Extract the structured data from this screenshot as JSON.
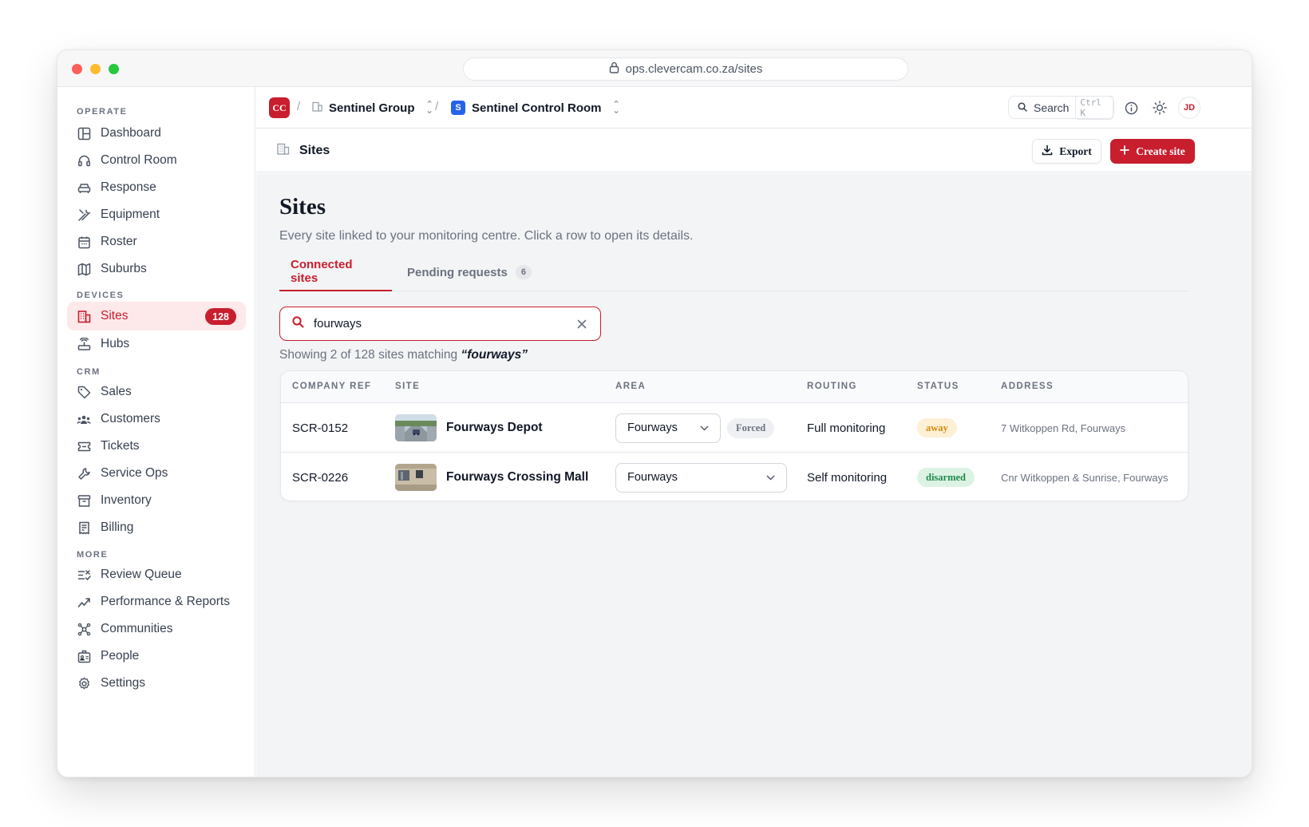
{
  "browser": {
    "url": "ops.clevercam.co.za/sites"
  },
  "sidebar": {
    "sections": [
      {
        "label": "OPERATE",
        "items": [
          {
            "label": "Dashboard",
            "icon": "dashboard-icon"
          },
          {
            "label": "Control Room",
            "icon": "headset-icon"
          },
          {
            "label": "Response",
            "icon": "car-icon"
          },
          {
            "label": "Equipment",
            "icon": "tools-icon"
          },
          {
            "label": "Roster",
            "icon": "calendar-icon"
          },
          {
            "label": "Suburbs",
            "icon": "map-icon"
          }
        ]
      },
      {
        "label": "DEVICES",
        "items": [
          {
            "label": "Sites",
            "icon": "building-icon",
            "badge": "128",
            "active": true
          },
          {
            "label": "Hubs",
            "icon": "router-icon"
          }
        ]
      },
      {
        "label": "CRM",
        "items": [
          {
            "label": "Sales",
            "icon": "tag-icon"
          },
          {
            "label": "Customers",
            "icon": "users-icon"
          },
          {
            "label": "Tickets",
            "icon": "ticket-icon"
          },
          {
            "label": "Service Ops",
            "icon": "wrench-icon"
          },
          {
            "label": "Inventory",
            "icon": "archive-icon"
          },
          {
            "label": "Billing",
            "icon": "receipt-icon"
          }
        ]
      },
      {
        "label": "MORE",
        "items": [
          {
            "label": "Review Queue",
            "icon": "list-check-icon"
          },
          {
            "label": "Performance & Reports",
            "icon": "trend-icon"
          },
          {
            "label": "Communities",
            "icon": "network-icon"
          },
          {
            "label": "People",
            "icon": "id-badge-icon"
          },
          {
            "label": "Settings",
            "icon": "gear-icon"
          }
        ]
      }
    ]
  },
  "topbar": {
    "org_logo": "CC",
    "org_name": "Sentinel Group",
    "room_badge": "S",
    "room_name": "Sentinel Control Room",
    "search_label": "Search",
    "search_shortcut": "Ctrl K",
    "avatar_initials": "JD"
  },
  "pagebar": {
    "title": "Sites",
    "export_label": "Export",
    "create_label": "Create site"
  },
  "page": {
    "heading": "Sites",
    "subtitle": "Every site linked to your monitoring centre. Click a row to open its details.",
    "tabs": [
      {
        "label": "Connected sites",
        "active": true
      },
      {
        "label": "Pending requests",
        "count": "6"
      }
    ],
    "search_value": "fourways",
    "result_prefix": "Showing 2 of 128 sites matching",
    "result_query": "“fourways”"
  },
  "table": {
    "columns": [
      "COMPANY REF",
      "SITE",
      "AREA",
      "ROUTING",
      "STATUS",
      "ADDRESS"
    ],
    "rows": [
      {
        "ref": "SCR-0152",
        "site": "Fourways Depot",
        "area": "Fourways",
        "forced": "Forced",
        "routing": "Full monitoring",
        "status": "away",
        "address": "7 Witkoppen Rd, Fourways"
      },
      {
        "ref": "SCR-0226",
        "site": "Fourways Crossing Mall",
        "area": "Fourways",
        "forced": "",
        "routing": "Self monitoring",
        "status": "disarmed",
        "address": "Cnr Witkoppen & Sunrise, Fourways"
      }
    ]
  },
  "colors": {
    "accent": "#c81e2e",
    "status_away_bg": "#fdf0d5",
    "status_away_fg": "#d68a0c",
    "status_disarmed_bg": "#dcf3e4",
    "status_disarmed_fg": "#1f8a4c"
  }
}
